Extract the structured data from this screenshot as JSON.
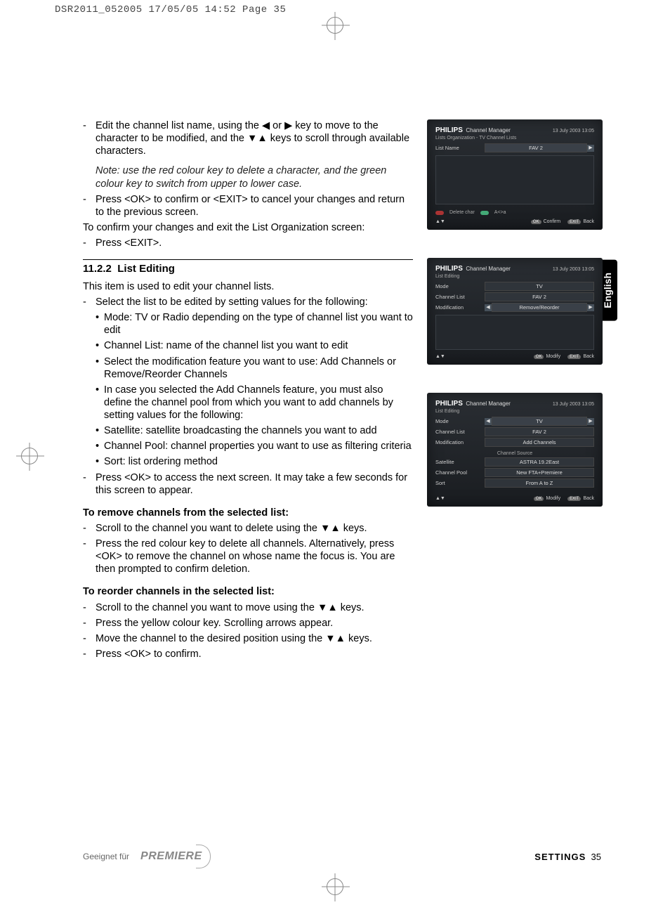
{
  "print_header": "DSR2011_052005  17/05/05  14:52  Page 35",
  "lang_tab": "English",
  "body": {
    "edit_line_1": "Edit the channel list name, using the ◀ or ▶  key to move to the character to be modified, and the ▼▲ keys to scroll through available characters.",
    "note": "Note: use the red colour key to delete a character, and the green colour key to switch from upper to lower case.",
    "press_ok_exit": "Press <OK> to confirm or <EXIT> to cancel your changes and return to the previous screen.",
    "confirm_exit_line": "To confirm your changes and exit the List Organization screen:",
    "press_exit": "Press <EXIT>.",
    "section_num": "11.2.2",
    "section_title": "List Editing",
    "intro": "This item is used to edit your channel lists.",
    "select_list": "Select the list to be edited by setting values for the following:",
    "b_mode": "Mode: TV or Radio depending on the type of channel list you want to edit",
    "b_chlist": "Channel List: name of the channel list you want to edit",
    "b_modif": "Select the modification feature you want to use: Add Channels or Remove/Reorder Channels",
    "b_incase": "In case you selected the Add Channels feature, you must also define the channel pool from which you want to add channels by setting values for the following:",
    "b_sat": "Satellite: satellite broadcasting the channels you want to add",
    "b_pool": "Channel Pool: channel properties you want to use as filtering criteria",
    "b_sort": "Sort: list ordering method",
    "press_ok_next": "Press <OK> to access the next screen. It may take a few seconds for this screen to appear.",
    "remove_head": "To remove channels from the selected list:",
    "rem_1": "Scroll to the channel you want to delete using the ▼▲ keys.",
    "rem_2": "Press the red colour key to delete all channels. Alternatively, press <OK> to remove the channel on whose name the focus is. You are then prompted to confirm deletion.",
    "reorder_head": "To reorder channels in the selected list:",
    "reo_1": "Scroll to the channel you want to move using the ▼▲ keys.",
    "reo_2": "Press the yellow colour key. Scrolling arrows appear.",
    "reo_3": "Move the channel to the desired position using the ▼▲ keys.",
    "reo_4": "Press <OK> to confirm."
  },
  "screens": {
    "s1": {
      "brand": "PHILIPS",
      "title": "Channel Manager",
      "date": "13 July 2003    13:05",
      "sub": "Lists Organization - TV Channel Lists",
      "row_label": "List Name",
      "row_value": "FAV 2",
      "bottom_delete": "Delete char",
      "bottom_case": "A<>a",
      "foot_ok": "Confirm",
      "foot_exit": "Back",
      "pill_ok": "OK",
      "pill_exit": "EXIT"
    },
    "s2": {
      "brand": "PHILIPS",
      "title": "Channel Manager",
      "date": "13 July 2003    13:05",
      "sub": "List Editing",
      "r1l": "Mode",
      "r1v": "TV",
      "r2l": "Channel List",
      "r2v": "FAV 2",
      "r3l": "Modification",
      "r3v": "Remove/Reorder",
      "foot_ok": "Modify",
      "foot_exit": "Back",
      "pill_ok": "OK",
      "pill_exit": "EXIT"
    },
    "s3": {
      "brand": "PHILIPS",
      "title": "Channel Manager",
      "date": "13 July 2003    13:05",
      "sub": "List Editing",
      "r1l": "Mode",
      "r1v": "TV",
      "r2l": "Channel List",
      "r2v": "FAV 2",
      "r3l": "Modification",
      "r3v": "Add Channels",
      "sec_label": "Channel Source",
      "r4l": "Satellite",
      "r4v": "ASTRA 19.2East",
      "r5l": "Channel Pool",
      "r5v": "New FTA+Premiere",
      "r6l": "Sort",
      "r6v": "From A to Z",
      "foot_ok": "Modify",
      "foot_exit": "Back",
      "pill_ok": "OK",
      "pill_exit": "EXIT"
    }
  },
  "footer": {
    "geeignet": "Geeignet für",
    "premiere": "PREMIERE",
    "category": "SETTINGS",
    "page": "35"
  }
}
